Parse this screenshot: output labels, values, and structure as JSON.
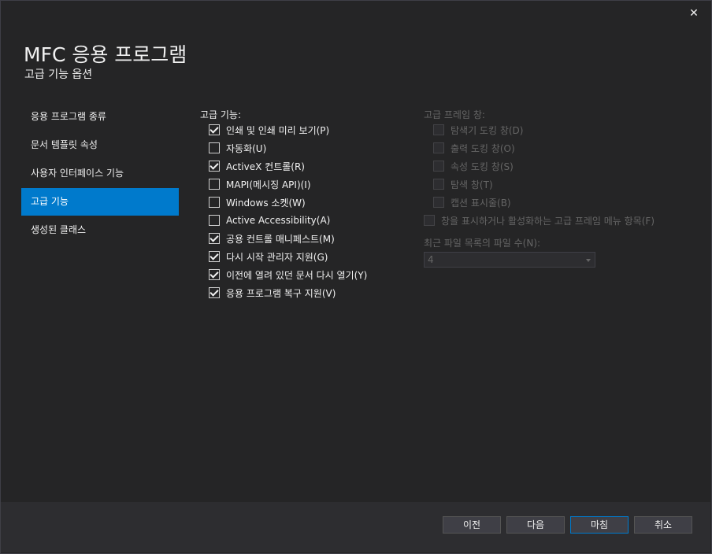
{
  "window": {
    "close_symbol": "✕"
  },
  "header": {
    "title": "MFC 응용 프로그램",
    "subtitle": "고급 기능 옵션"
  },
  "sidebar": {
    "items": [
      {
        "label": "응용 프로그램 종류",
        "active": false
      },
      {
        "label": "문서 템플릿 속성",
        "active": false
      },
      {
        "label": "사용자 인터페이스 기능",
        "active": false
      },
      {
        "label": "고급 기능",
        "active": true
      },
      {
        "label": "생성된 클래스",
        "active": false
      }
    ]
  },
  "advanced_features": {
    "label": "고급 기능:",
    "options": [
      {
        "label": "인쇄 및 인쇄 미리 보기(P)",
        "checked": true
      },
      {
        "label": "자동화(U)",
        "checked": false
      },
      {
        "label": "ActiveX 컨트롤(R)",
        "checked": true
      },
      {
        "label": "MAPI(메시징 API)(I)",
        "checked": false
      },
      {
        "label": "Windows 소켓(W)",
        "checked": false
      },
      {
        "label": "Active Accessibility(A)",
        "checked": false
      },
      {
        "label": "공용 컨트롤 매니페스트(M)",
        "checked": true
      },
      {
        "label": "다시 시작 관리자 지원(G)",
        "checked": true
      },
      {
        "label": "이전에 열려 있던 문서 다시 열기(Y)",
        "checked": true
      },
      {
        "label": "응용 프로그램 복구 지원(V)",
        "checked": true
      }
    ]
  },
  "frame_panes": {
    "label": "고급 프레임 창:",
    "options": [
      {
        "label": "탐색기 도킹 창(D)",
        "checked": false
      },
      {
        "label": "출력 도킹 창(O)",
        "checked": false
      },
      {
        "label": "속성 도킹 창(S)",
        "checked": false
      },
      {
        "label": "탐색 창(T)",
        "checked": false
      },
      {
        "label": "캡션 표시줄(B)",
        "checked": false
      }
    ],
    "menu_option": {
      "label": "창을 표시하거나 활성화하는 고급 프레임 메뉴 항목(F)",
      "checked": false
    }
  },
  "mru": {
    "label": "최근 파일 목록의 파일 수(N):",
    "value": "4"
  },
  "footer": {
    "prev_label": "이전",
    "next_label": "다음",
    "finish_label": "마침",
    "cancel_label": "취소"
  },
  "colors": {
    "background": "#252526",
    "accent": "#007acc",
    "disabled_text": "#656565"
  }
}
